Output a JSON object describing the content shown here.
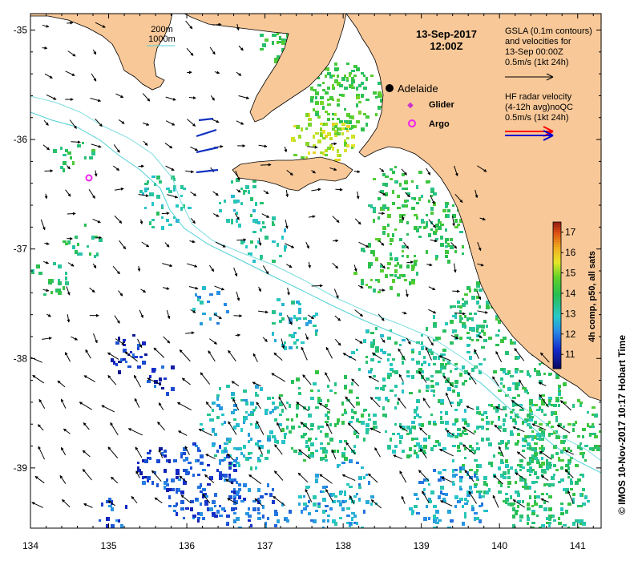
{
  "title": {
    "date": "13-Sep-2017",
    "time": "12:00Z"
  },
  "depth_legend": {
    "contour1": "200m",
    "contour2": "1000m",
    "color2": "#4fd0d6"
  },
  "gsla_legend": {
    "line1": "GSLA (0.1m contours)",
    "line2": "and velocities for",
    "line3": "13-Sep 00:00Z",
    "line4": "0.5m/s (1kt 24h)"
  },
  "hf_legend": {
    "line1": "HF radar velocity",
    "line2": "(4-12h avg)noQC",
    "line3": "0.5m/s (1kt 24h)"
  },
  "places": {
    "adelaide": "Adelaide",
    "glider": "Glider",
    "argo": "Argo"
  },
  "colorbar": {
    "title": "4h comp, p50, all sats",
    "ticks": [
      "11",
      "12",
      "13",
      "14",
      "15",
      "16",
      "17"
    ],
    "range": [
      10.3,
      17.5
    ]
  },
  "axes": {
    "x_ticks": [
      "134",
      "135",
      "136",
      "137",
      "138",
      "139",
      "140",
      "141"
    ],
    "y_ticks": [
      "-35",
      "-36",
      "-37",
      "-38",
      "-39"
    ],
    "x_range": [
      134,
      141.3
    ],
    "y_range": [
      -39.55,
      -34.85
    ]
  },
  "credit": "© IMOS 10-Nov-2017 10:17 Hobart Time",
  "colors": {
    "land": "#f8c898",
    "ocean": "#ffffff",
    "adelaide_marker": "#000000",
    "glider_marker": "#cc33cc",
    "argo_marker": "#ee22ee",
    "hf_arrow_red": "#ff0000",
    "hf_arrow_blue": "#0000cc"
  }
}
